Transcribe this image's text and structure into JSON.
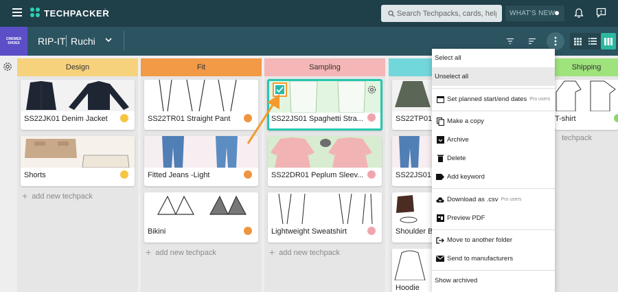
{
  "topbar": {
    "brand": "TECHPACKER",
    "brand_caret": "ʼ",
    "search_placeholder": "Search Techpacks, cards, help...",
    "whats_new": "WHAT'S NEW"
  },
  "subbar": {
    "folder_thumb_text": "CREWED SHOES",
    "folder_name": "RIP-IT",
    "user_name": "Ruchi"
  },
  "columns": [
    {
      "name": "Design",
      "color": "#f6d27c",
      "cards": [
        {
          "title": "SS22JK01 Denim Jacket",
          "dot": "#f6c542"
        },
        {
          "title": "Shorts",
          "dot": "#f6c542"
        }
      ],
      "add": "add new techpack"
    },
    {
      "name": "Fit",
      "color": "#f29a46",
      "cards": [
        {
          "title": "SS22TR01 Straight Pant",
          "dot": "#ee9540"
        },
        {
          "title": "Fitted Jeans -Light",
          "dot": "#ee9540"
        },
        {
          "title": "Bikini",
          "dot": "#ee9540"
        }
      ],
      "add": "add new techpack"
    },
    {
      "name": "Sampling",
      "color": "#f4b6b6",
      "cards": [
        {
          "title": "SS22JS01 Spaghetti Stra...",
          "dot": "#f0a5ad"
        },
        {
          "title": "SS22DR01 Peplum Sleev...",
          "dot": "#f0a5ad"
        },
        {
          "title": "Lightweight Sweatshirt",
          "dot": "#f0a5ad"
        }
      ],
      "add": "add new techpack"
    },
    {
      "name": "",
      "color": "#72d7db",
      "cards": [
        {
          "title": "SS22TP01",
          "dot": ""
        },
        {
          "title": "SS22JS01",
          "dot": ""
        },
        {
          "title": "Shoulder B",
          "dot": ""
        },
        {
          "title": "Hoodie",
          "dot": ""
        }
      ],
      "add": ""
    },
    {
      "name": "Shipping",
      "color": "#9ee37c",
      "cards": [
        {
          "title": "T-shirt",
          "dot": "#8ed66a"
        }
      ],
      "add": "techpack"
    }
  ],
  "menu": {
    "items": [
      {
        "label": "Select all",
        "icon": "",
        "pro": ""
      },
      {
        "label": "Unselect all",
        "icon": "",
        "pro": ""
      },
      {
        "label": "Set planned start/end dates",
        "icon": "calendar-icon",
        "pro": "Pro users"
      },
      {
        "label": "Make a copy",
        "icon": "copy-icon",
        "pro": ""
      },
      {
        "label": "Archive",
        "icon": "archive-icon",
        "pro": ""
      },
      {
        "label": "Delete",
        "icon": "trash-icon",
        "pro": ""
      },
      {
        "label": "Add keyword",
        "icon": "tag-icon",
        "pro": ""
      },
      {
        "label": "Download as .csv",
        "icon": "cloud-download-icon",
        "pro": "Pro users"
      },
      {
        "label": "Preview PDF",
        "icon": "pdf-icon",
        "pro": ""
      },
      {
        "label": "Move to another folder",
        "icon": "move-folder-icon",
        "pro": ""
      },
      {
        "label": "Send to manufacturers",
        "icon": "mail-icon",
        "pro": ""
      },
      {
        "label": "Show archived",
        "icon": "",
        "pro": ""
      }
    ]
  },
  "colors": {
    "topbar": "#1f3f49",
    "subbar": "#2c5360",
    "accent": "#2db7a0",
    "annotation": "#f39a2e"
  }
}
